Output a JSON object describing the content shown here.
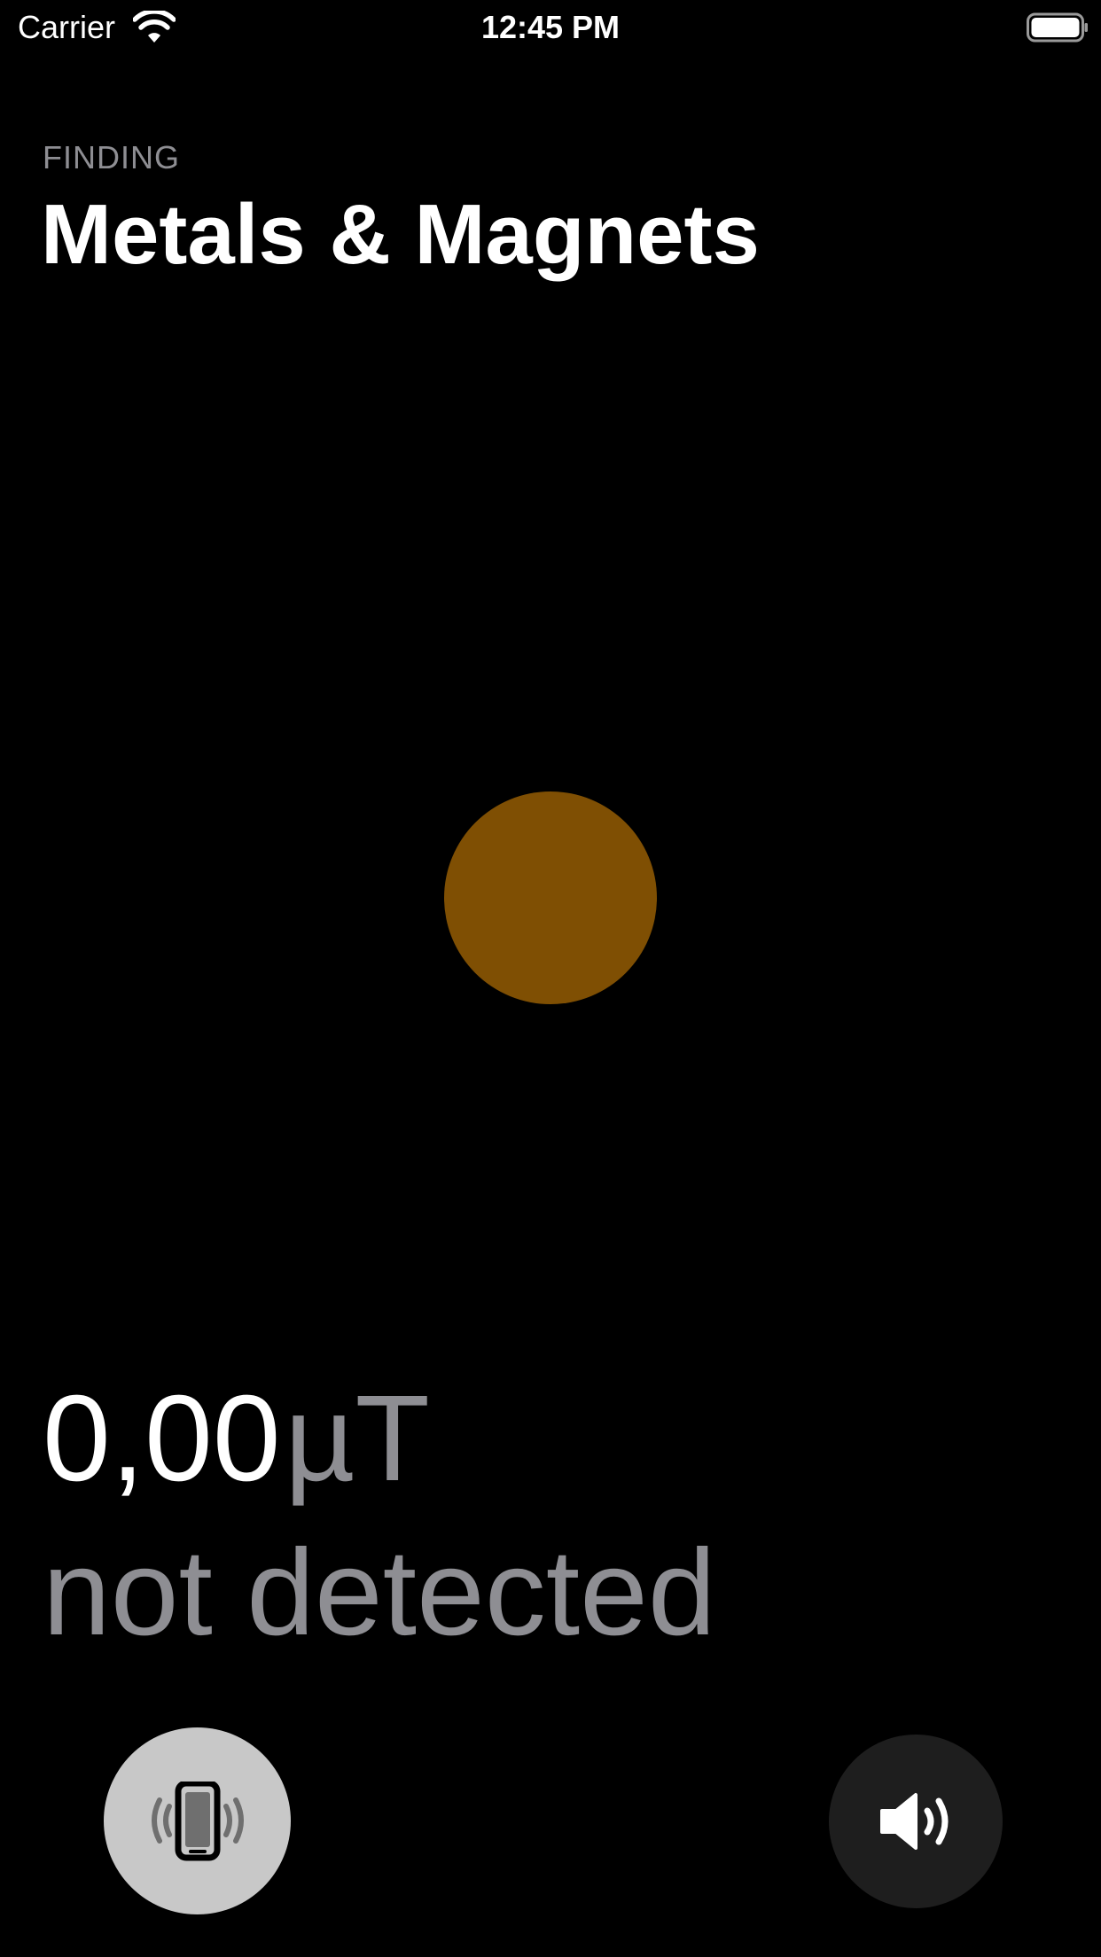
{
  "status_bar": {
    "carrier": "Carrier",
    "time": "12:45 PM",
    "icons": [
      "wifi-icon",
      "battery-icon"
    ]
  },
  "header": {
    "eyebrow": "FINDING",
    "title": "Metals & Magnets"
  },
  "indicator": {
    "color": "#7f4f03"
  },
  "readout": {
    "value": "0,00",
    "unit": "µT",
    "status": "not detected"
  },
  "controls": {
    "vibrate": {
      "icon": "phone-vibrate-icon",
      "active": true,
      "color": "#c8c8c8"
    },
    "sound": {
      "icon": "speaker-icon",
      "active": false,
      "color": "#1e1e1e"
    }
  },
  "colors": {
    "background": "#000000",
    "primary_text": "#ffffff",
    "secondary_text": "#8e8e93"
  }
}
